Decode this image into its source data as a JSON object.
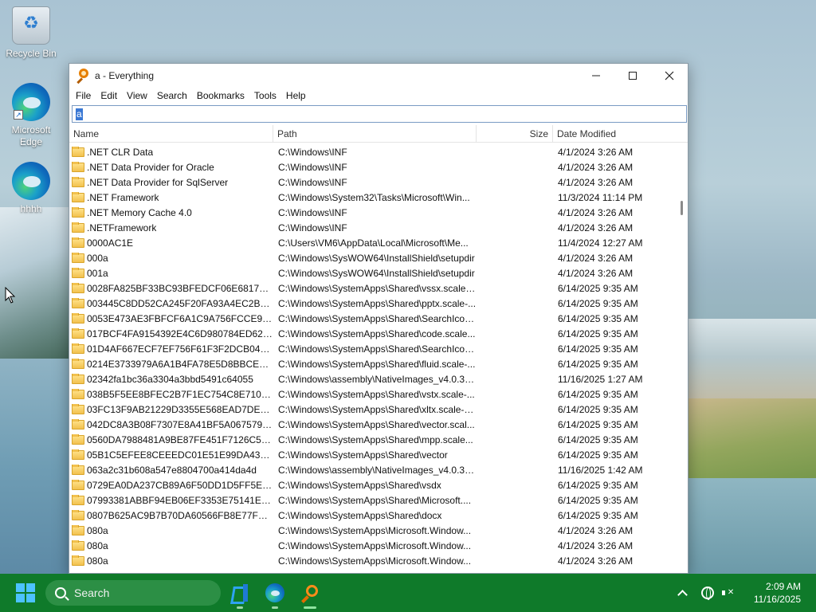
{
  "desktop": {
    "icons": [
      {
        "label": "Recycle Bin"
      },
      {
        "label": "Microsoft Edge"
      },
      {
        "label": "hhhh"
      }
    ]
  },
  "window": {
    "title": "a - Everything",
    "controls": {
      "minimize": "—",
      "maximize": "☐",
      "close": "✕"
    },
    "menu": [
      "File",
      "Edit",
      "View",
      "Search",
      "Bookmarks",
      "Tools",
      "Help"
    ],
    "search": {
      "value": "a"
    },
    "columns": {
      "name": "Name",
      "path": "Path",
      "size": "Size",
      "date": "Date Modified"
    },
    "rows": [
      {
        "name": ".NET CLR Data",
        "path": "C:\\Windows\\INF",
        "size": "",
        "date": "4/1/2024 3:26 AM"
      },
      {
        "name": ".NET Data Provider for Oracle",
        "path": "C:\\Windows\\INF",
        "size": "",
        "date": "4/1/2024 3:26 AM"
      },
      {
        "name": ".NET Data Provider for SqlServer",
        "path": "C:\\Windows\\INF",
        "size": "",
        "date": "4/1/2024 3:26 AM"
      },
      {
        "name": ".NET Framework",
        "path": "C:\\Windows\\System32\\Tasks\\Microsoft\\Win...",
        "size": "",
        "date": "11/3/2024 11:14 PM"
      },
      {
        "name": ".NET Memory Cache 4.0",
        "path": "C:\\Windows\\INF",
        "size": "",
        "date": "4/1/2024 3:26 AM"
      },
      {
        "name": ".NETFramework",
        "path": "C:\\Windows\\INF",
        "size": "",
        "date": "4/1/2024 3:26 AM"
      },
      {
        "name": "0000AC1E",
        "path": "C:\\Users\\VM6\\AppData\\Local\\Microsoft\\Me...",
        "size": "",
        "date": "11/4/2024 12:27 AM"
      },
      {
        "name": "000a",
        "path": "C:\\Windows\\SysWOW64\\InstallShield\\setupdir",
        "size": "",
        "date": "4/1/2024 3:26 AM"
      },
      {
        "name": "001a",
        "path": "C:\\Windows\\SysWOW64\\InstallShield\\setupdir",
        "size": "",
        "date": "4/1/2024 3:26 AM"
      },
      {
        "name": "0028FA825BF33BC93BFEDCF06E68179E1E1...",
        "path": "C:\\Windows\\SystemApps\\Shared\\vssx.scale-...",
        "size": "",
        "date": "6/14/2025 9:35 AM"
      },
      {
        "name": "003445C8DD52CA245F20FA93A4EC2B1487...",
        "path": "C:\\Windows\\SystemApps\\Shared\\pptx.scale-...",
        "size": "",
        "date": "6/14/2025 9:35 AM"
      },
      {
        "name": "0053E473AE3FBFCF6A1C9A756FCCE9B29A...",
        "path": "C:\\Windows\\SystemApps\\Shared\\SearchIcon...",
        "size": "",
        "date": "6/14/2025 9:35 AM"
      },
      {
        "name": "017BCF4FA9154392E4C6D980784ED629E01...",
        "path": "C:\\Windows\\SystemApps\\Shared\\code.scale...",
        "size": "",
        "date": "6/14/2025 9:35 AM"
      },
      {
        "name": "01D4AF667ECF7EF756F61F3F2DCB04EF60C...",
        "path": "C:\\Windows\\SystemApps\\Shared\\SearchIcon...",
        "size": "",
        "date": "6/14/2025 9:35 AM"
      },
      {
        "name": "0214E3733979A6A1B4FA78E5D8BBCE753A...",
        "path": "C:\\Windows\\SystemApps\\Shared\\fluid.scale-...",
        "size": "",
        "date": "6/14/2025 9:35 AM"
      },
      {
        "name": "02342fa1bc36a3304a3bbd5491c64055",
        "path": "C:\\Windows\\assembly\\NativeImages_v4.0.30...",
        "size": "",
        "date": "11/16/2025 1:27 AM"
      },
      {
        "name": "038B5F5EE8BFEC2B7F1EC754C8E7108FB6D...",
        "path": "C:\\Windows\\SystemApps\\Shared\\vstx.scale-...",
        "size": "",
        "date": "6/14/2025 9:35 AM"
      },
      {
        "name": "03FC13F9AB21229D3355E568EAD7DE2A12...",
        "path": "C:\\Windows\\SystemApps\\Shared\\xltx.scale-4...",
        "size": "",
        "date": "6/14/2025 9:35 AM"
      },
      {
        "name": "042DC8A3B08F7307E8A41BF5A0675792251...",
        "path": "C:\\Windows\\SystemApps\\Shared\\vector.scal...",
        "size": "",
        "date": "6/14/2025 9:35 AM"
      },
      {
        "name": "0560DA7988481A9BE87FE451F7126C5A59A...",
        "path": "C:\\Windows\\SystemApps\\Shared\\mpp.scale...",
        "size": "",
        "date": "6/14/2025 9:35 AM"
      },
      {
        "name": "05B1C5EFEE8CEEEDC01E51E99DA435D9DD...",
        "path": "C:\\Windows\\SystemApps\\Shared\\vector",
        "size": "",
        "date": "6/14/2025 9:35 AM"
      },
      {
        "name": "063a2c31b608a547e8804700a414da4d",
        "path": "C:\\Windows\\assembly\\NativeImages_v4.0.30...",
        "size": "",
        "date": "11/16/2025 1:42 AM"
      },
      {
        "name": "0729EA0DA237CB89A6F50DD1D5FF5E1E55...",
        "path": "C:\\Windows\\SystemApps\\Shared\\vsdx",
        "size": "",
        "date": "6/14/2025 9:35 AM"
      },
      {
        "name": "07993381ABBF94EB06EF3353E75141E75542...",
        "path": "C:\\Windows\\SystemApps\\Shared\\Microsoft....",
        "size": "",
        "date": "6/14/2025 9:35 AM"
      },
      {
        "name": "0807B625AC9B7B70DA60566FB8E77FF7EE...",
        "path": "C:\\Windows\\SystemApps\\Shared\\docx",
        "size": "",
        "date": "6/14/2025 9:35 AM"
      },
      {
        "name": "080a",
        "path": "C:\\Windows\\SystemApps\\Microsoft.Window...",
        "size": "",
        "date": "4/1/2024 3:26 AM"
      },
      {
        "name": "080a",
        "path": "C:\\Windows\\SystemApps\\Microsoft.Window...",
        "size": "",
        "date": "4/1/2024 3:26 AM"
      },
      {
        "name": "080a",
        "path": "C:\\Windows\\SystemApps\\Microsoft.Window...",
        "size": "",
        "date": "4/1/2024 3:26 AM"
      }
    ]
  },
  "taskbar": {
    "search_label": "Search",
    "apps": [
      {
        "name": "vscode-icon"
      },
      {
        "name": "edge-icon"
      },
      {
        "name": "everything-icon",
        "active": true
      }
    ],
    "clock": {
      "time": "2:09 AM",
      "date": "11/16/2025"
    }
  }
}
